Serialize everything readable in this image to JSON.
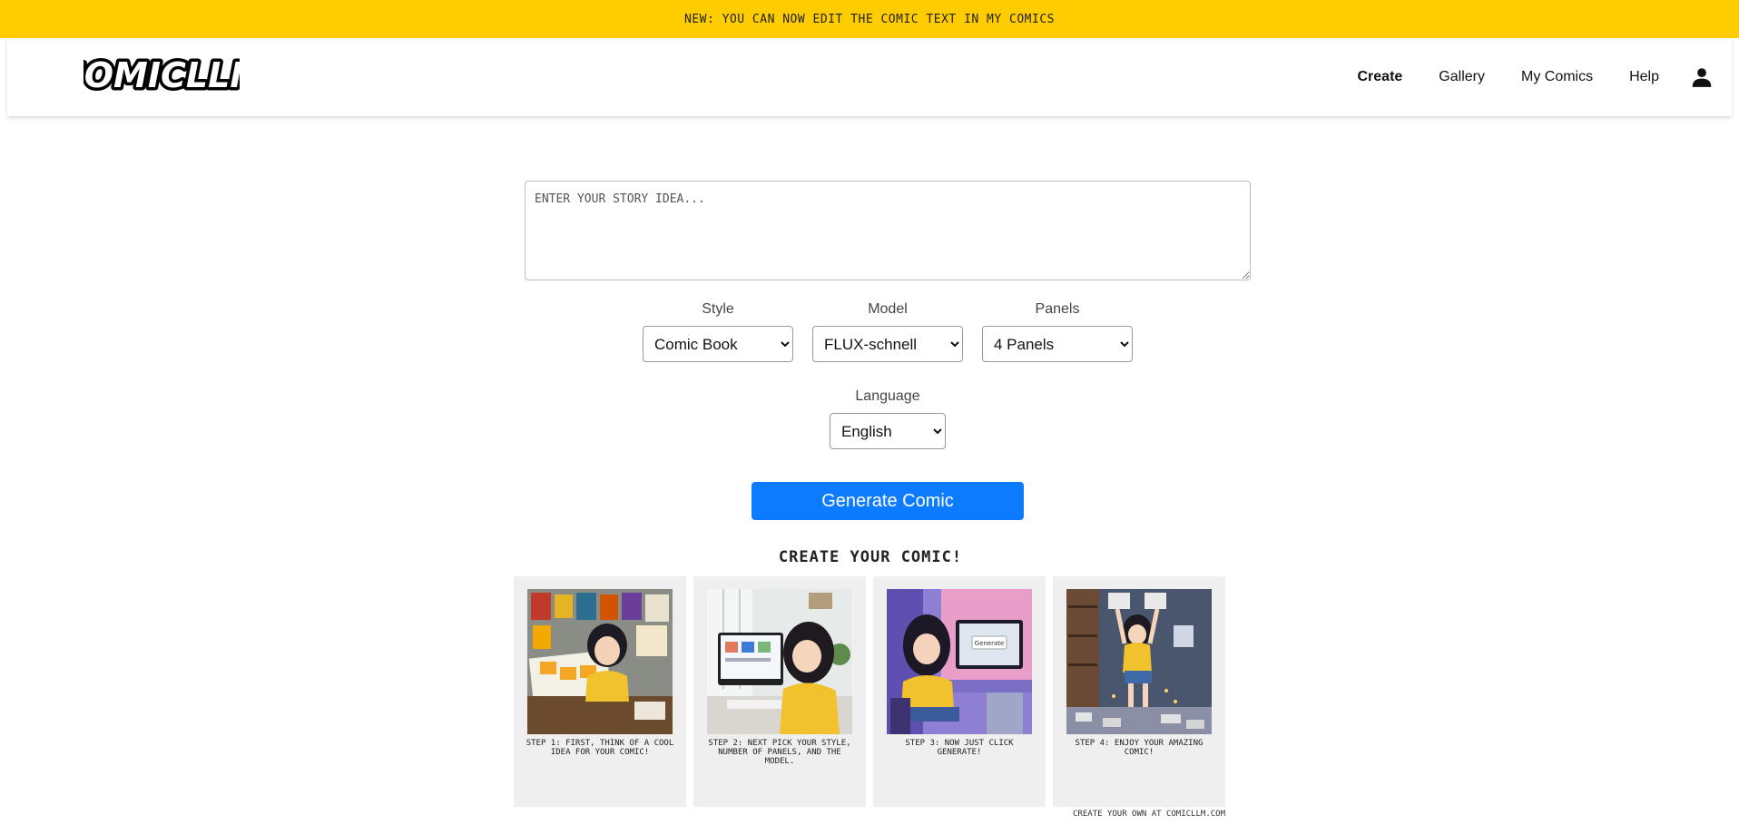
{
  "banner": {
    "text": "NEW: YOU CAN NOW EDIT THE COMIC TEXT IN MY COMICS"
  },
  "logo": {
    "text": "COMICLLM"
  },
  "nav": {
    "create": "Create",
    "gallery": "Gallery",
    "my_comics": "My Comics",
    "help": "Help",
    "user_icon": "person-icon"
  },
  "story": {
    "placeholder": "ENTER YOUR STORY IDEA..."
  },
  "options": {
    "style": {
      "label": "Style",
      "selected": "Comic Book"
    },
    "model": {
      "label": "Model",
      "selected": "FLUX-schnell"
    },
    "panels": {
      "label": "Panels",
      "selected": "4 Panels"
    },
    "language": {
      "label": "Language",
      "selected": "English"
    }
  },
  "generate": {
    "label": "Generate Comic"
  },
  "tutorial": {
    "title": "CREATE YOUR COMIC!",
    "steps": [
      {
        "caption": "STEP 1: FIRST, THINK OF A COOL IDEA FOR YOUR COMIC!"
      },
      {
        "caption": "STEP 2: NEXT PICK YOUR STYLE, NUMBER OF PANELS, AND THE MODEL."
      },
      {
        "caption": "STEP 3: NOW JUST CLICK GENERATE!",
        "screen_text": "Generate"
      },
      {
        "caption": "STEP 4: ENJOY YOUR AMAZING COMIC!"
      }
    ]
  },
  "footer": {
    "text": "CREATE YOUR OWN AT COMICLLM.COM"
  },
  "colors": {
    "banner": "#ffcc00",
    "button": "#0d7bff",
    "panel_bg": "#efefef"
  }
}
